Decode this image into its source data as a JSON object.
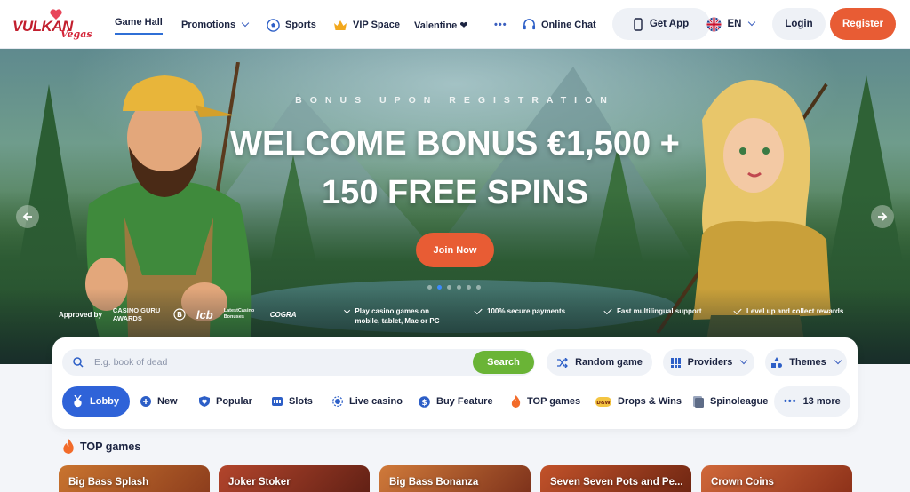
{
  "header": {
    "logo_text": "VULKAN",
    "logo_script": "Vegas",
    "nav": [
      {
        "label": "Game Hall",
        "icon": ""
      },
      {
        "label": "Promotions",
        "icon": "chevron-down-icon"
      },
      {
        "label": "Sports",
        "icon": "soccer-ball-icon"
      },
      {
        "label": "VIP Space",
        "icon": "crown-icon"
      },
      {
        "label": "Valentine ❤",
        "icon": ""
      },
      {
        "label": "•••",
        "icon": ""
      },
      {
        "label": "Online Chat",
        "icon": "headset-icon"
      }
    ],
    "get_app": "Get App",
    "language": "EN",
    "login": "Login",
    "register": "Register"
  },
  "hero": {
    "subtitle": "BONUS UPON REGISTRATION",
    "title_line1": "WELCOME BONUS €1,500 +",
    "title_line2": "150 FREE SPINS",
    "cta": "Join Now",
    "slides": 6,
    "active_slide": 2,
    "approved_label": "Approved by",
    "badges": [
      "CASINO GURU AWARDS",
      "lcb",
      "LatestCasino Bonuses",
      "COGRA"
    ],
    "features": [
      "Play casino games on mobile, tablet, Mac or PC",
      "100% secure payments",
      "Fast multilingual support",
      "Level up and collect rewards"
    ]
  },
  "search": {
    "placeholder": "E.g. book of dead",
    "button": "Search",
    "random": "Random game",
    "providers": "Providers",
    "themes": "Themes"
  },
  "categories": [
    {
      "label": "Lobby",
      "icon": "medal-icon"
    },
    {
      "label": "New",
      "icon": "plus-circle-icon"
    },
    {
      "label": "Popular",
      "icon": "heart-shield-icon"
    },
    {
      "label": "Slots",
      "icon": "slot-machine-icon"
    },
    {
      "label": "Live casino",
      "icon": "live-dot-icon"
    },
    {
      "label": "Buy Feature",
      "icon": "dollar-coin-icon"
    },
    {
      "label": "TOP games",
      "icon": "flame-icon"
    },
    {
      "label": "Drops & Wins",
      "icon": "drops-wins-icon"
    },
    {
      "label": "Spinoleague",
      "icon": "league-icon"
    },
    {
      "label": "13 more",
      "icon": "more-dots-icon"
    }
  ],
  "top_games": {
    "title": "TOP games",
    "games": [
      "Big Bass Splash",
      "Joker Stoker",
      "Big Bass Bonanza",
      "Seven Seven Pots and Pe...",
      "Crown Coins"
    ]
  },
  "colors": {
    "accent": "#e85c34",
    "primary": "#2f63d8",
    "search": "#6ab436"
  }
}
